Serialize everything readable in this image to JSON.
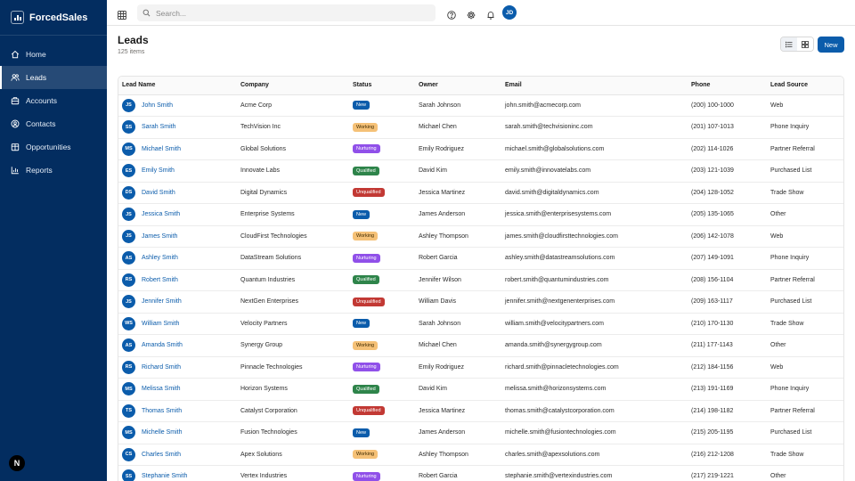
{
  "app": {
    "name": "ForcedSales"
  },
  "nav": [
    {
      "label": "Home",
      "icon": "home-icon",
      "active": false
    },
    {
      "label": "Leads",
      "icon": "users-icon",
      "active": true
    },
    {
      "label": "Accounts",
      "icon": "building-icon",
      "active": false
    },
    {
      "label": "Contacts",
      "icon": "contact-icon",
      "active": false
    },
    {
      "label": "Opportunities",
      "icon": "briefcase-icon",
      "active": false
    },
    {
      "label": "Reports",
      "icon": "bar-chart-icon",
      "active": false
    }
  ],
  "sidebar_footer": {
    "label": "N"
  },
  "topbar": {
    "search_placeholder": "Search...",
    "user_initials": "JD"
  },
  "page": {
    "title": "Leads",
    "count": "125 items",
    "new_label": "New"
  },
  "colors": {
    "sidebar": "#032d60",
    "accent": "#0b5cab",
    "working": "#f5c177",
    "nurturing": "#9050e9",
    "qualified": "#2e844a",
    "unqualified": "#c23934"
  },
  "table": {
    "columns": [
      "Lead Name",
      "Company",
      "Status",
      "Owner",
      "Email",
      "Phone",
      "Lead Source"
    ],
    "rows": [
      {
        "initials": "JS",
        "name": "John Smith",
        "company": "Acme Corp",
        "status": "New",
        "owner": "Sarah Johnson",
        "email": "john.smith@acmecorp.com",
        "phone": "(200) 100-1000",
        "source": "Web"
      },
      {
        "initials": "SS",
        "name": "Sarah Smith",
        "company": "TechVision Inc",
        "status": "Working",
        "owner": "Michael Chen",
        "email": "sarah.smith@techvisioninc.com",
        "phone": "(201) 107-1013",
        "source": "Phone Inquiry"
      },
      {
        "initials": "MS",
        "name": "Michael Smith",
        "company": "Global Solutions",
        "status": "Nurturing",
        "owner": "Emily Rodriguez",
        "email": "michael.smith@globalsolutions.com",
        "phone": "(202) 114-1026",
        "source": "Partner Referral"
      },
      {
        "initials": "ES",
        "name": "Emily Smith",
        "company": "Innovate Labs",
        "status": "Qualified",
        "owner": "David Kim",
        "email": "emily.smith@innovatelabs.com",
        "phone": "(203) 121-1039",
        "source": "Purchased List"
      },
      {
        "initials": "DS",
        "name": "David Smith",
        "company": "Digital Dynamics",
        "status": "Unqualified",
        "owner": "Jessica Martinez",
        "email": "david.smith@digitaldynamics.com",
        "phone": "(204) 128-1052",
        "source": "Trade Show"
      },
      {
        "initials": "JS",
        "name": "Jessica Smith",
        "company": "Enterprise Systems",
        "status": "New",
        "owner": "James Anderson",
        "email": "jessica.smith@enterprisesystems.com",
        "phone": "(205) 135-1065",
        "source": "Other"
      },
      {
        "initials": "JS",
        "name": "James Smith",
        "company": "CloudFirst Technologies",
        "status": "Working",
        "owner": "Ashley Thompson",
        "email": "james.smith@cloudfirsttechnologies.com",
        "phone": "(206) 142-1078",
        "source": "Web"
      },
      {
        "initials": "AS",
        "name": "Ashley Smith",
        "company": "DataStream Solutions",
        "status": "Nurturing",
        "owner": "Robert Garcia",
        "email": "ashley.smith@datastreamsolutions.com",
        "phone": "(207) 149-1091",
        "source": "Phone Inquiry"
      },
      {
        "initials": "RS",
        "name": "Robert Smith",
        "company": "Quantum Industries",
        "status": "Qualified",
        "owner": "Jennifer Wilson",
        "email": "robert.smith@quantumindustries.com",
        "phone": "(208) 156-1104",
        "source": "Partner Referral"
      },
      {
        "initials": "JS",
        "name": "Jennifer Smith",
        "company": "NextGen Enterprises",
        "status": "Unqualified",
        "owner": "William Davis",
        "email": "jennifer.smith@nextgenenterprises.com",
        "phone": "(209) 163-1117",
        "source": "Purchased List"
      },
      {
        "initials": "WS",
        "name": "William Smith",
        "company": "Velocity Partners",
        "status": "New",
        "owner": "Sarah Johnson",
        "email": "william.smith@velocitypartners.com",
        "phone": "(210) 170-1130",
        "source": "Trade Show"
      },
      {
        "initials": "AS",
        "name": "Amanda Smith",
        "company": "Synergy Group",
        "status": "Working",
        "owner": "Michael Chen",
        "email": "amanda.smith@synergygroup.com",
        "phone": "(211) 177-1143",
        "source": "Other"
      },
      {
        "initials": "RS",
        "name": "Richard Smith",
        "company": "Pinnacle Technologies",
        "status": "Nurturing",
        "owner": "Emily Rodriguez",
        "email": "richard.smith@pinnacletechnologies.com",
        "phone": "(212) 184-1156",
        "source": "Web"
      },
      {
        "initials": "MS",
        "name": "Melissa Smith",
        "company": "Horizon Systems",
        "status": "Qualified",
        "owner": "David Kim",
        "email": "melissa.smith@horizonsystems.com",
        "phone": "(213) 191-1169",
        "source": "Phone Inquiry"
      },
      {
        "initials": "TS",
        "name": "Thomas Smith",
        "company": "Catalyst Corporation",
        "status": "Unqualified",
        "owner": "Jessica Martinez",
        "email": "thomas.smith@catalystcorporation.com",
        "phone": "(214) 198-1182",
        "source": "Partner Referral"
      },
      {
        "initials": "MS",
        "name": "Michelle Smith",
        "company": "Fusion Technologies",
        "status": "New",
        "owner": "James Anderson",
        "email": "michelle.smith@fusiontechnologies.com",
        "phone": "(215) 205-1195",
        "source": "Purchased List"
      },
      {
        "initials": "CS",
        "name": "Charles Smith",
        "company": "Apex Solutions",
        "status": "Working",
        "owner": "Ashley Thompson",
        "email": "charles.smith@apexsolutions.com",
        "phone": "(216) 212-1208",
        "source": "Trade Show"
      },
      {
        "initials": "SS",
        "name": "Stephanie Smith",
        "company": "Vertex Industries",
        "status": "Nurturing",
        "owner": "Robert Garcia",
        "email": "stephanie.smith@vertexindustries.com",
        "phone": "(217) 219-1221",
        "source": "Other"
      }
    ]
  }
}
